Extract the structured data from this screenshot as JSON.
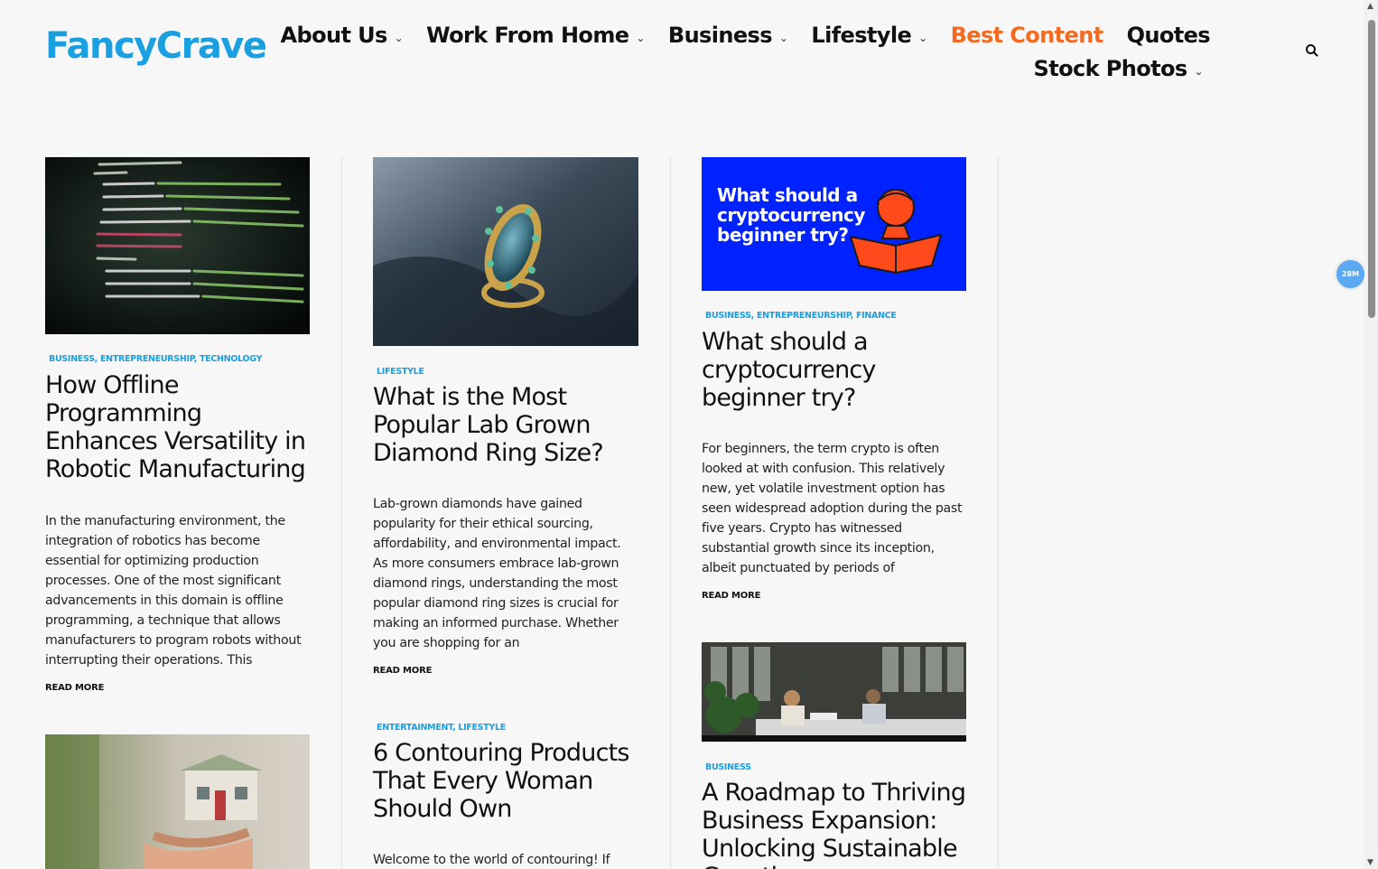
{
  "site": {
    "logo": "FancyCrave"
  },
  "nav": {
    "row1": [
      {
        "label": "About Us",
        "dropdown": true
      },
      {
        "label": "Work From Home",
        "dropdown": true
      },
      {
        "label": "Business",
        "dropdown": true
      },
      {
        "label": "Lifestyle",
        "dropdown": true
      },
      {
        "label": "Best Content",
        "dropdown": false,
        "active": true
      },
      {
        "label": "Quotes",
        "dropdown": false
      }
    ],
    "row2": [
      {
        "label": "Stock Photos",
        "dropdown": true
      }
    ],
    "chevron": "⌄",
    "search_icon": "search-icon"
  },
  "posts": {
    "col1": [
      {
        "category": "BUSINESS, ENTREPRENEURSHIP, TECHNOLOGY",
        "title": "How Offline Programming Enhances Versatility in Robotic Manufacturing",
        "excerpt": "In the manufacturing environment, the integration of robotics has become essential for optimizing production processes. One of the most significant advancements in this domain is offline programming, a technique that allows manufacturers to program robots without interrupting their operations. This",
        "read_more": "READ MORE"
      }
    ],
    "col2": [
      {
        "category": "LIFESTYLE",
        "title": "What is the Most Popular Lab Grown Diamond Ring Size?",
        "excerpt": "Lab-grown diamonds have gained popularity for their ethical sourcing, affordability, and environmental impact. As more consumers embrace lab-grown diamond rings, understanding the most popular diamond ring sizes is crucial for making an informed purchase. Whether you are shopping for an",
        "read_more": "READ MORE"
      },
      {
        "category": "ENTERTAINMENT, LIFESTYLE",
        "title": "6 Contouring Products That Every Woman Should Own",
        "excerpt": "Welcome to the world of contouring! If"
      }
    ],
    "col3": [
      {
        "image_text": "What should a cryptocurrency beginner try?",
        "category": "BUSINESS, ENTREPRENEURSHIP, FINANCE",
        "title": "What should a cryptocurrency beginner try?",
        "excerpt": "For beginners, the term crypto is often looked at with confusion. This relatively new, yet volatile investment option has seen widespread adoption during the past five years. Crypto has witnessed substantial growth since its inception, albeit punctuated by periods of",
        "read_more": "READ MORE"
      },
      {
        "category": "BUSINESS",
        "title": "A Roadmap to Thriving Business Expansion: Unlocking Sustainable Growth"
      }
    ]
  },
  "widget": {
    "badge": "28M"
  },
  "colors": {
    "brand": "#1a9fe0",
    "active_nav": "#f26b21",
    "crypto_bg": "#0022ff",
    "crypto_accent": "#ff4a1c"
  }
}
